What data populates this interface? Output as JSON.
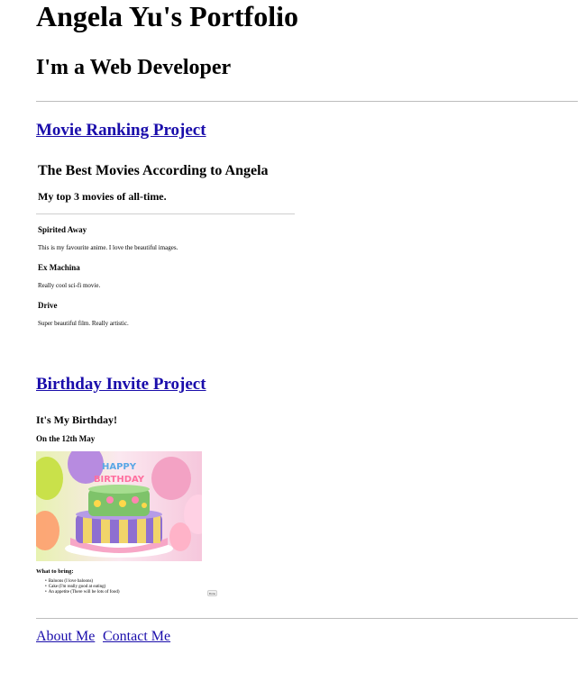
{
  "header": {
    "title": "Angela Yu's Portfolio",
    "subtitle": "I'm a Web Developer"
  },
  "projects": {
    "movie": {
      "link_label": "Movie Ranking Project",
      "heading": "The Best Movies According to Angela",
      "subheading": "My top 3 movies of all-time.",
      "movies": [
        {
          "title": "Spirited Away",
          "desc": "This is my favourite anime. I love the beautiful images."
        },
        {
          "title": "Ex Machina",
          "desc": "Really cool sci-fi movie."
        },
        {
          "title": "Drive",
          "desc": "Super beautiful film. Really artistic."
        }
      ]
    },
    "birthday": {
      "link_label": "Birthday Invite Project",
      "heading": "It's My Birthday!",
      "date": "On the 12th May",
      "image_text": "HAPPY BIRTHDAY",
      "bring_heading": "What to bring:",
      "items": [
        "Baloons (I love baloons)",
        "Cake (I'm really good at eating)",
        "An appetite (There will be lots of food)"
      ],
      "button_label": "Done"
    }
  },
  "footer": {
    "about_label": "About Me",
    "contact_label": "Contact Me"
  }
}
